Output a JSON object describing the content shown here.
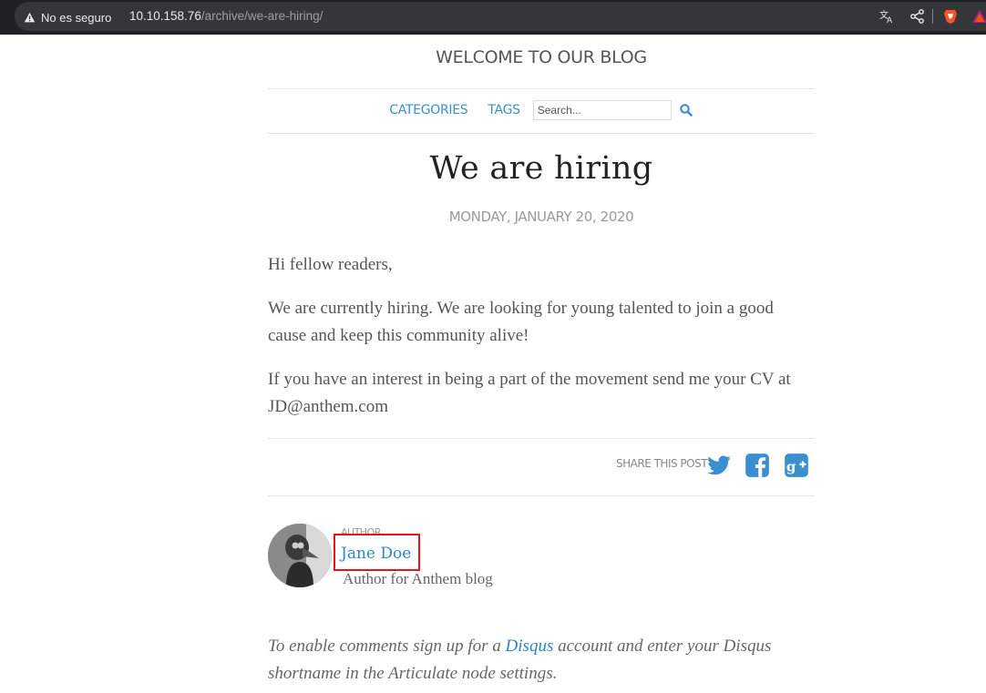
{
  "browser": {
    "security_label": "No es seguro",
    "url_host": "10.10.158.76",
    "url_path": "/archive/we-are-hiring/"
  },
  "site": {
    "title": "WELCOME TO OUR BLOG"
  },
  "nav": {
    "categories": "CATEGORIES",
    "tags": "TAGS",
    "search_placeholder": "Search..."
  },
  "post": {
    "title": "We are hiring",
    "date": "MONDAY, JANUARY 20, 2020",
    "paragraphs": [
      "Hi fellow readers,",
      "We are currently hiring. We are looking for young talented to join a good cause and keep this community alive!",
      "If you have an interest in being a part of the movement send me your CV at JD@anthem.com"
    ]
  },
  "share": {
    "label": "SHARE THIS POST",
    "icons": [
      "twitter-icon",
      "facebook-icon",
      "google-plus-icon"
    ]
  },
  "author": {
    "label": "AUTHOR",
    "name": "Jane Doe",
    "description": "Author for Anthem blog"
  },
  "comments": {
    "before": "To enable comments sign up for a ",
    "link": "Disqus",
    "after": " account and enter your Disqus shortname in the Articulate node settings."
  },
  "colors": {
    "link": "#3a8fd0",
    "highlight": "#e8141c"
  }
}
